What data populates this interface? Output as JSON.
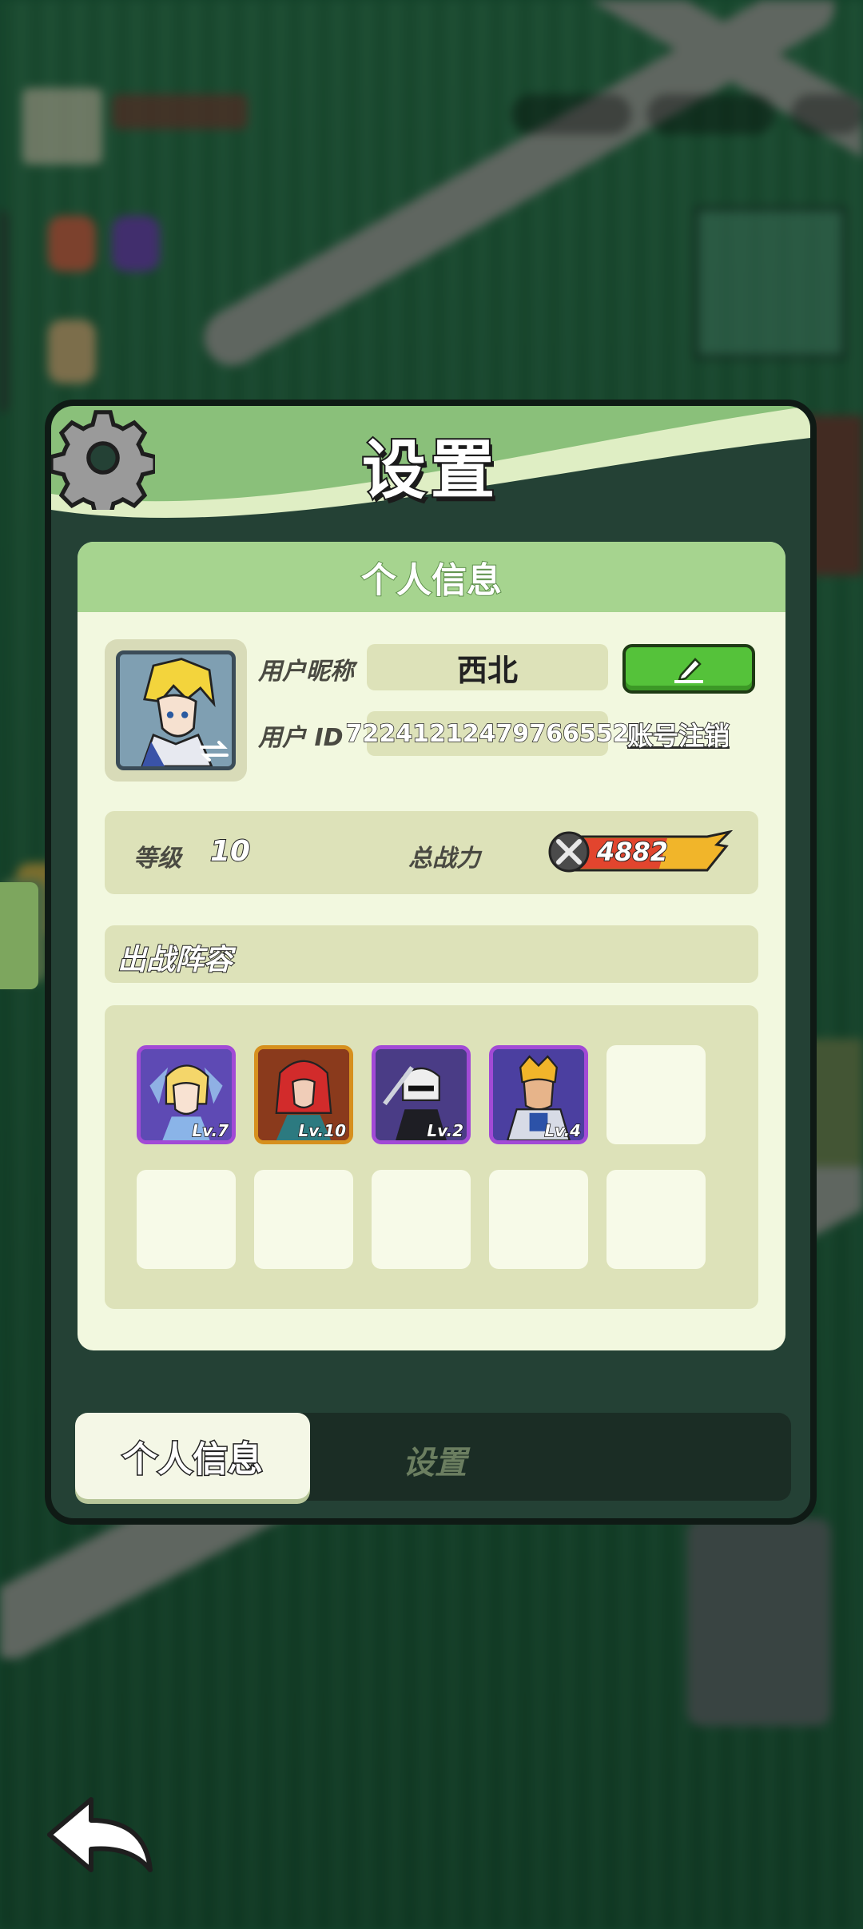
{
  "panel": {
    "title": "设置",
    "card_title": "个人信息"
  },
  "profile": {
    "nickname_label": "用户昵称",
    "nickname": "西北",
    "id_label": "用户 ID",
    "user_id": "72241212479766552",
    "cancel_account": "账号注销",
    "edit_icon": "pencil-icon"
  },
  "stats": {
    "level_label": "等级",
    "level": "10",
    "power_label": "总战力",
    "power": "4882"
  },
  "lineup": {
    "title": "出战阵容",
    "heroes": [
      {
        "level": "Lv.7",
        "frame": "purple"
      },
      {
        "level": "Lv.10",
        "frame": "orange"
      },
      {
        "level": "Lv.2",
        "frame": "purple"
      },
      {
        "level": "Lv.4",
        "frame": "purple"
      }
    ],
    "empty_slots": 6
  },
  "tabs": {
    "personal": "个人信息",
    "settings": "设置"
  },
  "colors": {
    "header_green": "#8ac07a",
    "card_bg": "#f2f8df",
    "edit_green": "#55c23a",
    "purple_frame": "#a24ad6",
    "orange_frame": "#d6901e"
  }
}
